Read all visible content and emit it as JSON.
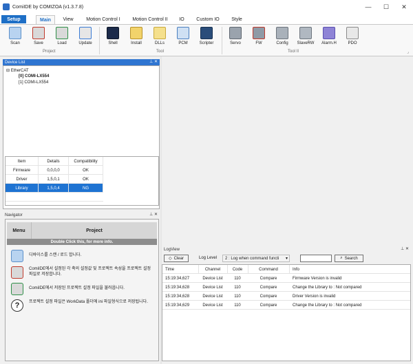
{
  "window": {
    "title": "ComiIDE by COMIZOA (v1.3.7.8)",
    "minimize": "—",
    "maximize": "☐",
    "close": "✕"
  },
  "tabs": {
    "setup": "Setup",
    "items": [
      "Main",
      "View",
      "Motion Control I",
      "Motion Control II",
      "IO",
      "Custom IO",
      "Style"
    ]
  },
  "ribbon": {
    "buttons": [
      "Scan",
      "Save",
      "Load",
      "Update",
      "Shell",
      "Install",
      "DLLs",
      "PCM",
      "Scripter",
      "Servo",
      "FW",
      "Config",
      "SlaveRW",
      "Alarm.H",
      "PDO"
    ],
    "groups": [
      "Project",
      "Tool",
      "Tool II"
    ],
    "icons": [
      "scan-icon",
      "save-icon",
      "load-icon",
      "update-icon",
      "shell-icon",
      "install-icon",
      "dlls-icon",
      "pcm-icon",
      "scripter-icon",
      "servo-icon",
      "fw-icon",
      "config-icon",
      "slaverw-icon",
      "alarm-icon",
      "pdo-icon"
    ]
  },
  "device_list": {
    "title": "Device List",
    "tree": {
      "root": "EtherCAT",
      "children": [
        "[0] COMI-LX554",
        "[1] COMI-LX554"
      ]
    },
    "columns": [
      "Item",
      "Details",
      "Compatibility"
    ],
    "rows": [
      [
        "Firmware",
        "0,0,0,0",
        "OK"
      ],
      [
        "Driver",
        "1,5,0,1",
        "OK"
      ],
      [
        "Library",
        "1,5,0,4",
        "NG"
      ]
    ],
    "selected_row": 2
  },
  "navigator": {
    "title": "Navigator",
    "head": [
      "Menu",
      "Project"
    ],
    "strip": "Double Click this, for more info.",
    "items": [
      "디바이스를 스캔 / 로드 합니다.",
      "ComiIDE에서 설정된 각 축의 설정값 및 프로젝트 속성을 프로젝트 설정 파일로 저장합니다.",
      "ComiIDE에서 저장된 프로젝트 설정 파일을 불러옵니다.",
      "프로젝트 설정 파일은 WorkData 폴더에 ini 파일형식으로 저장됩니다."
    ]
  },
  "logview": {
    "title": "LogView",
    "clear": "Clear",
    "level_label": "Log Level",
    "level_value": "2 : Log when command functi",
    "search_value": "",
    "search_label": "Search",
    "columns": [
      "Time",
      "Channel",
      "Code",
      "Command",
      "Info"
    ],
    "rows": [
      [
        "15:19:34,627",
        "Device List",
        "110",
        "Compare",
        "Firmware Version is invalid"
      ],
      [
        "15:19:34,628",
        "Device List",
        "110",
        "Compare",
        "Change the Library to : Not compared"
      ],
      [
        "15:19:34,628",
        "Device List",
        "110",
        "Compare",
        "Driver Version is invalid"
      ],
      [
        "15:19:34,629",
        "Device List",
        "110",
        "Compare",
        "Change the Library to : Not compared"
      ]
    ]
  },
  "colors": {
    "accent": "#1e6fc6",
    "panel_header": "#2f75d1",
    "selection": "#1e73d2"
  }
}
